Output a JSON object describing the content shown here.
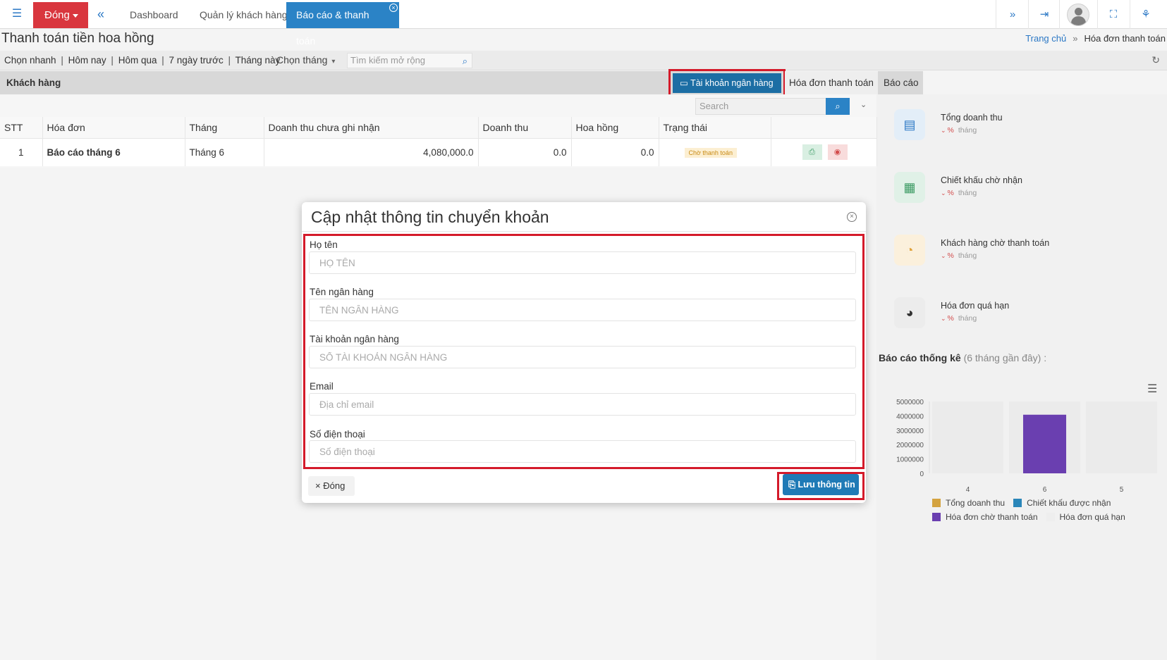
{
  "topbar": {
    "close_label": "Đóng",
    "tabs": [
      {
        "label": "Dashboard"
      },
      {
        "label": "Quản lý khách hàng"
      },
      {
        "label": "Báo cáo & thanh toán"
      }
    ],
    "tab_close_glyph": "×",
    "icons": [
      "menu-icon",
      "double-chevron-left-icon",
      "double-chevron-right-icon",
      "login-icon",
      "user-icon",
      "fullscreen-icon",
      "sitemap-icon"
    ]
  },
  "header": {
    "title": "Thanh toán tiền hoa hồng",
    "breadcrumb": {
      "home": "Trang chủ",
      "separator": "»",
      "current": "Hóa đơn thanh toán"
    }
  },
  "filters": {
    "quick": [
      "Chọn nhanh",
      "Hôm nay",
      "Hôm qua",
      "7 ngày trước",
      "Tháng này"
    ],
    "divider": "|",
    "month_select": "Chọn tháng",
    "search_placeholder": "Tìm kiếm mở rộng"
  },
  "section": {
    "left_label": "Khách hàng",
    "bank_button": "Tài khoản ngân hàng",
    "tabs": [
      "Hóa đơn thanh toán",
      "Báo cáo"
    ]
  },
  "table": {
    "search_placeholder": "Search",
    "columns": [
      "STT",
      "Hóa đơn",
      "Tháng",
      "Doanh thu chưa ghi nhận",
      "Doanh thu",
      "Hoa hồng",
      "Trạng thái"
    ],
    "rows": [
      {
        "stt": "1",
        "invoice": "Báo cáo tháng 6",
        "month": "Tháng 6",
        "unrecorded": "4,080,000.0",
        "revenue": "0.0",
        "commission": "0.0",
        "status": "Chờ thanh toán"
      }
    ]
  },
  "stats": [
    {
      "label": "Tổng doanh thu",
      "pct": "%",
      "period": "tháng",
      "icon": "report-icon",
      "color": "#2b78c5",
      "bg": "#e3eef8"
    },
    {
      "label": "Chiết khấu chờ nhận",
      "pct": "%",
      "period": "tháng",
      "icon": "document-icon",
      "color": "#3c9b64",
      "bg": "#e0f1e7"
    },
    {
      "label": "Khách hàng chờ thanh toán",
      "pct": "%",
      "period": "tháng",
      "icon": "chart-pie-icon",
      "color": "#e0a23a",
      "bg": "#fbf0dc"
    },
    {
      "label": "Hóa đơn quá hạn",
      "pct": "%",
      "period": "tháng",
      "icon": "chart-pie-outline-icon",
      "color": "#333333",
      "bg": "#ececec"
    }
  ],
  "report": {
    "title": "Báo cáo thống kê",
    "subtitle": "(6 tháng gần đây) :"
  },
  "chart_data": {
    "type": "bar",
    "categories": [
      "4",
      "6",
      "5"
    ],
    "ylim": [
      0,
      5000000
    ],
    "yticks": [
      "5000000",
      "4000000",
      "3000000",
      "2000000",
      "1000000",
      "0"
    ],
    "series": [
      {
        "name": "Tổng doanh thu",
        "color": "#d4a340",
        "values": [
          0,
          0,
          0
        ]
      },
      {
        "name": "Chiết khấu được nhận",
        "color": "#2a86b9",
        "values": [
          0,
          0,
          0
        ]
      },
      {
        "name": "Hóa đơn chờ thanh toán",
        "color": "#6a3fb0",
        "values": [
          0,
          4080000,
          0
        ]
      },
      {
        "name": "Hóa đơn quá hạn",
        "color": "#eeeeee",
        "values": [
          0,
          0,
          0
        ]
      }
    ]
  },
  "modal": {
    "title": "Cập nhật thông tin chuyển khoản",
    "fields": [
      {
        "label": "Họ tên",
        "placeholder": "HỌ TÊN",
        "value": ""
      },
      {
        "label": "Tên ngân hàng",
        "placeholder": "TÊN NGÂN HÀNG",
        "value": ""
      },
      {
        "label": "Tài khoản ngân hàng",
        "placeholder": "SỐ TÀI KHOẢN NGÂN HÀNG",
        "value": ""
      },
      {
        "label": "Email",
        "placeholder": "Địa chỉ email",
        "value": ""
      },
      {
        "label": "Số điện thoại",
        "placeholder": "Số điện thoại",
        "value": ""
      }
    ],
    "cancel_label": "Đóng",
    "cancel_glyph": "×",
    "save_label": "Lưu thông tin"
  },
  "colors": {
    "accent": "#2b83c6",
    "danger": "#d9363e",
    "highlight": "#d41a2a"
  }
}
